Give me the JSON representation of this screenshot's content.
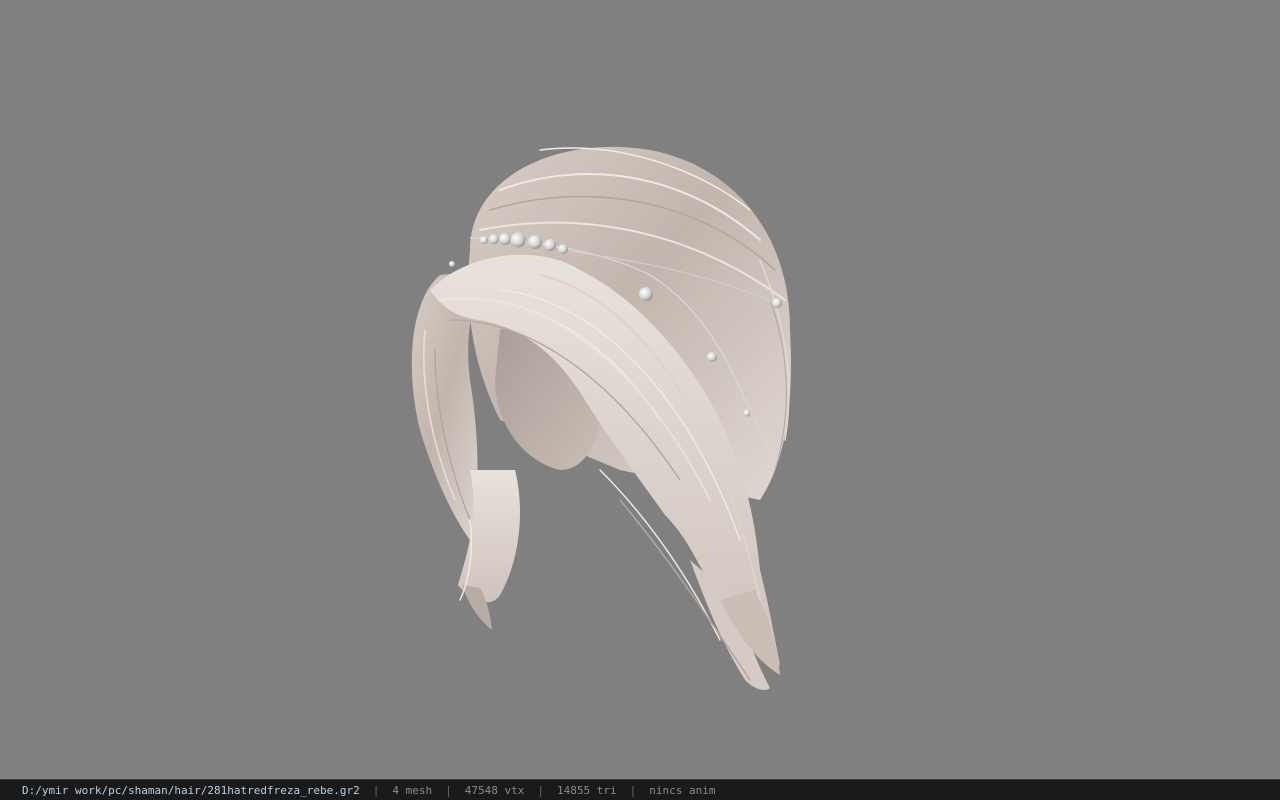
{
  "viewer": {
    "background_color": "#808080",
    "model": {
      "semantic": "hair-model",
      "hair_color": "#cbbfb8",
      "accessory": "pearl-hairpin"
    }
  },
  "status_bar": {
    "file_path": "D:/ymir work/pc/shaman/hair/281hatredfreza_rebe.gr2",
    "separator": "|",
    "mesh_count": "4 mesh",
    "vertex_count": "47548 vtx",
    "triangle_count": "14855 tri",
    "animation": "nincs anim",
    "colors": {
      "background": "#1a1a1a",
      "path": "#b7d0e8",
      "text": "#8a8a8a"
    }
  }
}
